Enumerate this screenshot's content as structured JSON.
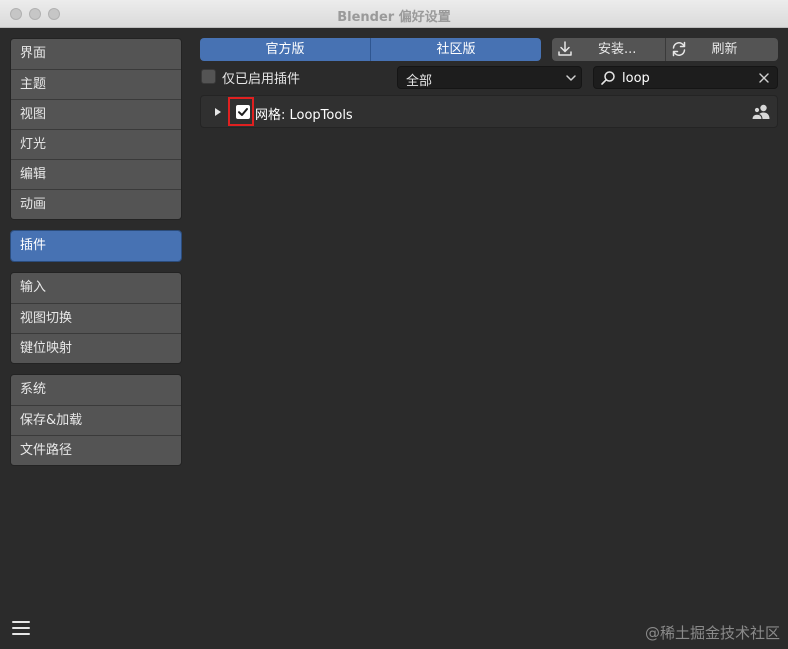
{
  "window": {
    "title": "Blender 偏好设置"
  },
  "sidebar": {
    "groups": [
      {
        "items": [
          {
            "label": "界面"
          },
          {
            "label": "主题"
          },
          {
            "label": "视图"
          },
          {
            "label": "灯光"
          },
          {
            "label": "编辑"
          },
          {
            "label": "动画"
          }
        ]
      },
      {
        "items": [
          {
            "label": "插件",
            "active": true
          }
        ]
      },
      {
        "items": [
          {
            "label": "输入"
          },
          {
            "label": "视图切换"
          },
          {
            "label": "键位映射"
          }
        ]
      },
      {
        "items": [
          {
            "label": "系统"
          },
          {
            "label": "保存&加载"
          },
          {
            "label": "文件路径"
          }
        ]
      }
    ]
  },
  "toolbar": {
    "tabs": [
      {
        "label": "官方版"
      },
      {
        "label": "社区版"
      }
    ],
    "install_label": "安装...",
    "refresh_label": "刷新"
  },
  "filter": {
    "enabled_only_label": "仅已启用插件",
    "category_value": "全部",
    "search_value": "loop",
    "search_placeholder": ""
  },
  "addons": [
    {
      "name": "网格: LoopTools",
      "enabled": true,
      "icon": "community-users-icon"
    }
  ],
  "watermark": "@稀土掘金技术社区",
  "colors": {
    "accent": "#4772b3",
    "highlight": "#e02020"
  }
}
